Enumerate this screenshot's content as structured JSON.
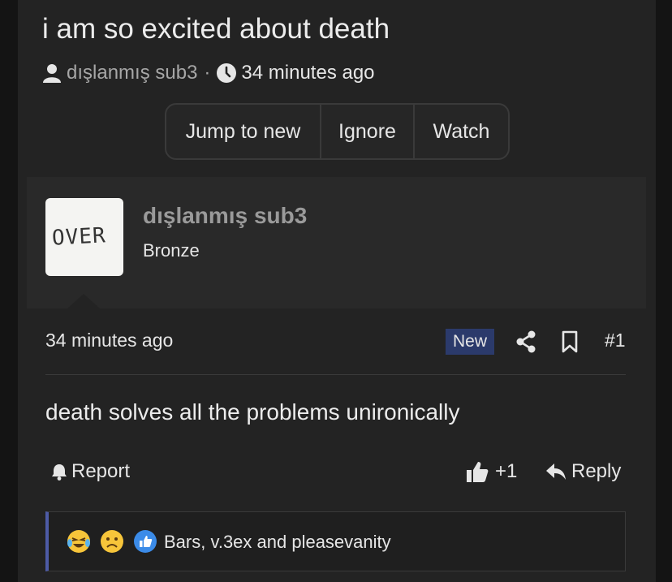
{
  "thread": {
    "title": "i am so excited about death",
    "author": "dışlanmış sub3",
    "separator": "·",
    "time": "34 minutes ago"
  },
  "actions": {
    "jump_label": "Jump to new",
    "ignore_label": "Ignore",
    "watch_label": "Watch"
  },
  "post": {
    "avatar_text": "OVER",
    "username": "dışlanmış sub3",
    "rank": "Bronze",
    "time": "34 minutes ago",
    "badge": "New",
    "number": "#1",
    "body": "death solves all the problems unironically",
    "report_label": "Report",
    "like_count": "+1",
    "reply_label": "Reply"
  },
  "reactions": {
    "icons": [
      "laughing-crying-emoji",
      "sad-emoji",
      "like-emoji"
    ],
    "text": "Bars, v.3ex and pleasevanity"
  },
  "colors": {
    "background": "#232323",
    "user_block": "#292929",
    "badge_new": "#2b3a6b",
    "reaction_accent": "#4d5ba6"
  }
}
